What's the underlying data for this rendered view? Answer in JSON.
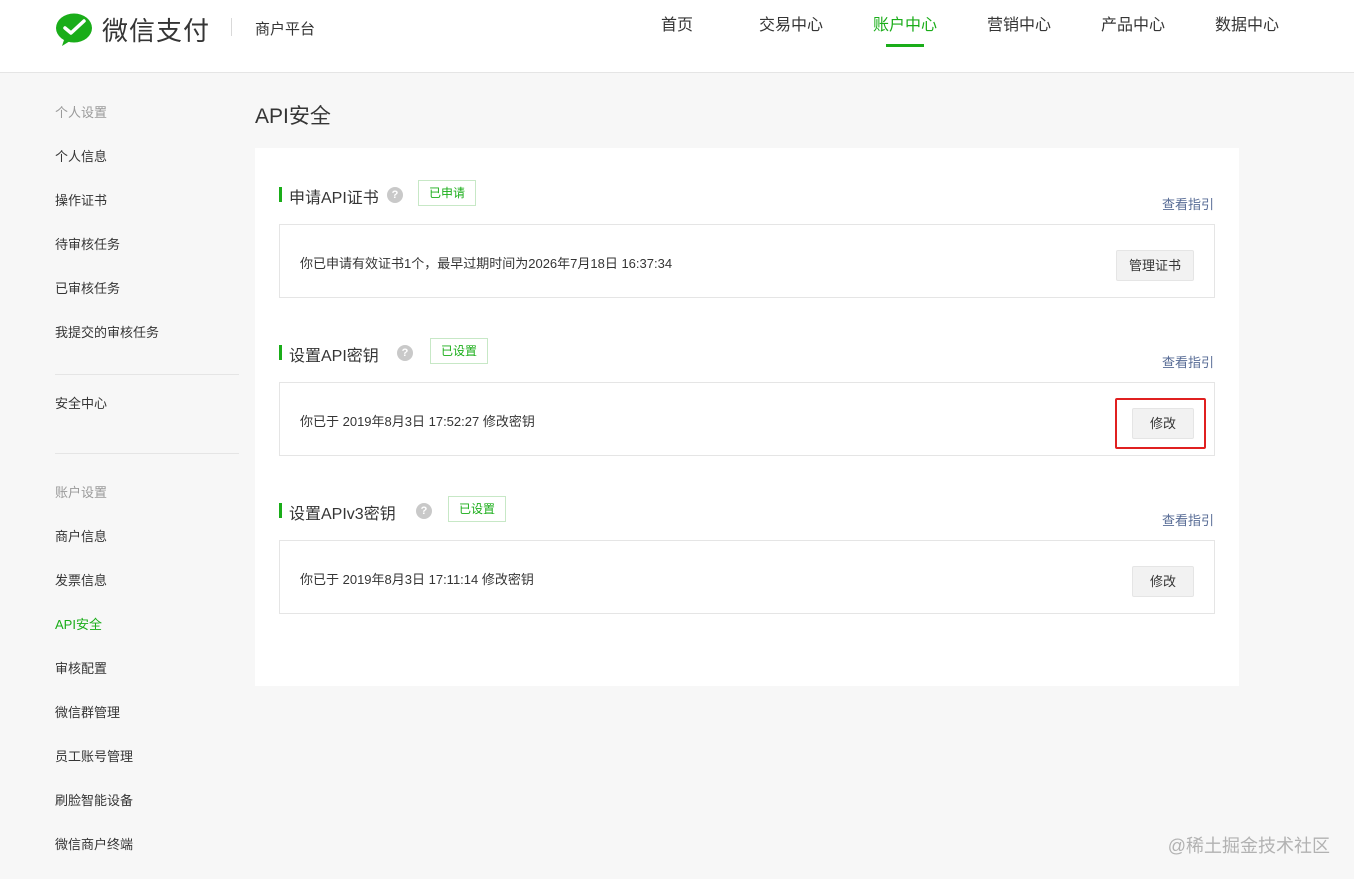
{
  "header": {
    "brand": "微信支付",
    "platform": "商户平台",
    "nav": [
      {
        "label": "首页",
        "active": false
      },
      {
        "label": "交易中心",
        "active": false
      },
      {
        "label": "账户中心",
        "active": true
      },
      {
        "label": "营销中心",
        "active": false
      },
      {
        "label": "产品中心",
        "active": false
      },
      {
        "label": "数据中心",
        "active": false
      }
    ]
  },
  "sidebar": {
    "group1": {
      "title": "个人设置",
      "items": [
        "个人信息",
        "操作证书",
        "待审核任务",
        "已审核任务",
        "我提交的审核任务"
      ]
    },
    "group2": {
      "items": [
        "安全中心"
      ]
    },
    "group3": {
      "title": "账户设置",
      "items": [
        "商户信息",
        "发票信息",
        "API安全",
        "审核配置",
        "微信群管理",
        "员工账号管理",
        "刷脸智能设备",
        "微信商户终端"
      ]
    }
  },
  "main": {
    "title": "API安全",
    "sections": [
      {
        "title": "申请API证书",
        "help_icon": "?",
        "status": "已申请",
        "guide_link": "查看指引",
        "description": "你已申请有效证书1个，最早过期时间为2026年7月18日 16:37:34",
        "button": "管理证书"
      },
      {
        "title": "设置API密钥",
        "help_icon": "?",
        "status": "已设置",
        "guide_link": "查看指引",
        "description": "你已于 2019年8月3日 17:52:27 修改密钥",
        "button": "修改"
      },
      {
        "title": "设置APIv3密钥",
        "help_icon": "?",
        "status": "已设置",
        "guide_link": "查看指引",
        "description": "你已于 2019年8月3日 17:11:14 修改密钥",
        "button": "修改"
      }
    ]
  },
  "watermark": "@稀土掘金技术社区",
  "colors": {
    "accent": "#1aad19",
    "link": "#576b95",
    "highlight": "#e02020"
  }
}
